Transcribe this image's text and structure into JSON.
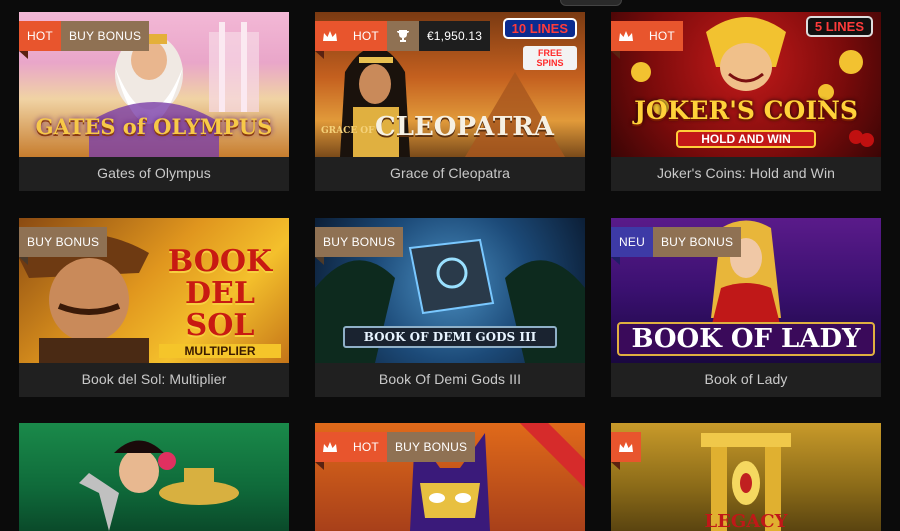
{
  "games": [
    {
      "title": "Gates of Olympus",
      "badges": [
        "HOT",
        "BUY BONUS"
      ],
      "art_title": "GATES of OLYMPUS"
    },
    {
      "title": "Grace of Cleopatra",
      "badges": [
        "HOT"
      ],
      "jackpot": "€1,950.13",
      "lines_label": "10 LINES",
      "free_spins": "FREE SPINS",
      "art_title": "CLEOPATRA",
      "art_prefix": "GRACE OF"
    },
    {
      "title": "Joker's Coins: Hold and Win",
      "badges": [
        "HOT"
      ],
      "lines_label": "5 LINES",
      "art_title": "JOKER'S COINS",
      "art_subtitle": "HOLD AND WIN"
    },
    {
      "title": "Book del Sol: Multiplier",
      "badges": [
        "BUY BONUS"
      ],
      "art_title": "BOOK DEL SOL",
      "art_subtitle": "MULTIPLIER"
    },
    {
      "title": "Book Of Demi Gods III",
      "badges": [
        "BUY BONUS"
      ],
      "art_title": "BOOK OF DEMI GODS III"
    },
    {
      "title": "Book of Lady",
      "badges": [
        "NEU",
        "BUY BONUS"
      ],
      "art_title": "BOOK OF LADY"
    },
    {
      "title": "",
      "badges": [],
      "art_title": ""
    },
    {
      "title": "",
      "badges": [
        "HOT",
        "BUY BONUS"
      ],
      "art_title": ""
    },
    {
      "title": "",
      "badges": [],
      "art_title": "LEGACY"
    }
  ],
  "colors": {
    "hot": "#e8552d",
    "buy_bonus": "#8f7153",
    "neu": "#3d3aa6",
    "card": "#202020",
    "page": "#0b0b0b"
  },
  "icons": {
    "crown": "crown-icon",
    "trophy": "trophy-icon"
  }
}
